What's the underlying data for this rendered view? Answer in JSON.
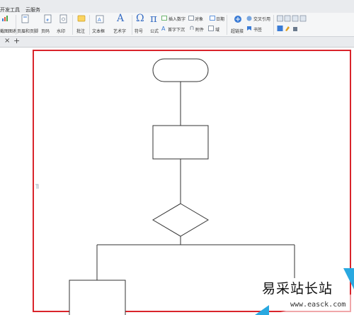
{
  "menu": {
    "items": [
      "开发工具",
      "云服务"
    ]
  },
  "ribbon": {
    "items": [
      {
        "label": "截图图表",
        "icon": "chart-icon"
      },
      {
        "label": "页眉和页脚",
        "icon": "header-footer-icon"
      },
      {
        "label": "页码",
        "icon": "page-number-icon"
      },
      {
        "label": "水印",
        "icon": "watermark-icon"
      },
      {
        "label": "批注",
        "icon": "comment-icon"
      },
      {
        "label": "文本框",
        "icon": "textbox-icon"
      },
      {
        "label": "艺术字",
        "icon": "wordart-icon"
      },
      {
        "label": "符号",
        "icon": "omega-icon"
      },
      {
        "label": "公式",
        "icon": "pi-icon"
      },
      {
        "label": "插入数字",
        "icon": "insert-number-icon"
      },
      {
        "label": "对象",
        "icon": "object-icon"
      },
      {
        "label": "日期",
        "icon": "date-icon"
      },
      {
        "label": "首字下沉",
        "icon": "drop-cap-icon"
      },
      {
        "label": "附件",
        "icon": "attachment-icon"
      },
      {
        "label": "域",
        "icon": "field-icon"
      },
      {
        "label": "超链接",
        "icon": "hyperlink-icon"
      },
      {
        "label": "交叉引用",
        "icon": "cross-ref-icon"
      },
      {
        "label": "书签",
        "icon": "bookmark-icon"
      }
    ]
  },
  "tabs": {
    "close": "×",
    "add": "+"
  },
  "watermark": {
    "text": "易采站长站",
    "url": "www.easck.com"
  },
  "colors": {
    "canvas_border": "#d9242b",
    "shape_stroke": "#333333",
    "ribbon_bg": "#f5f6f7"
  }
}
